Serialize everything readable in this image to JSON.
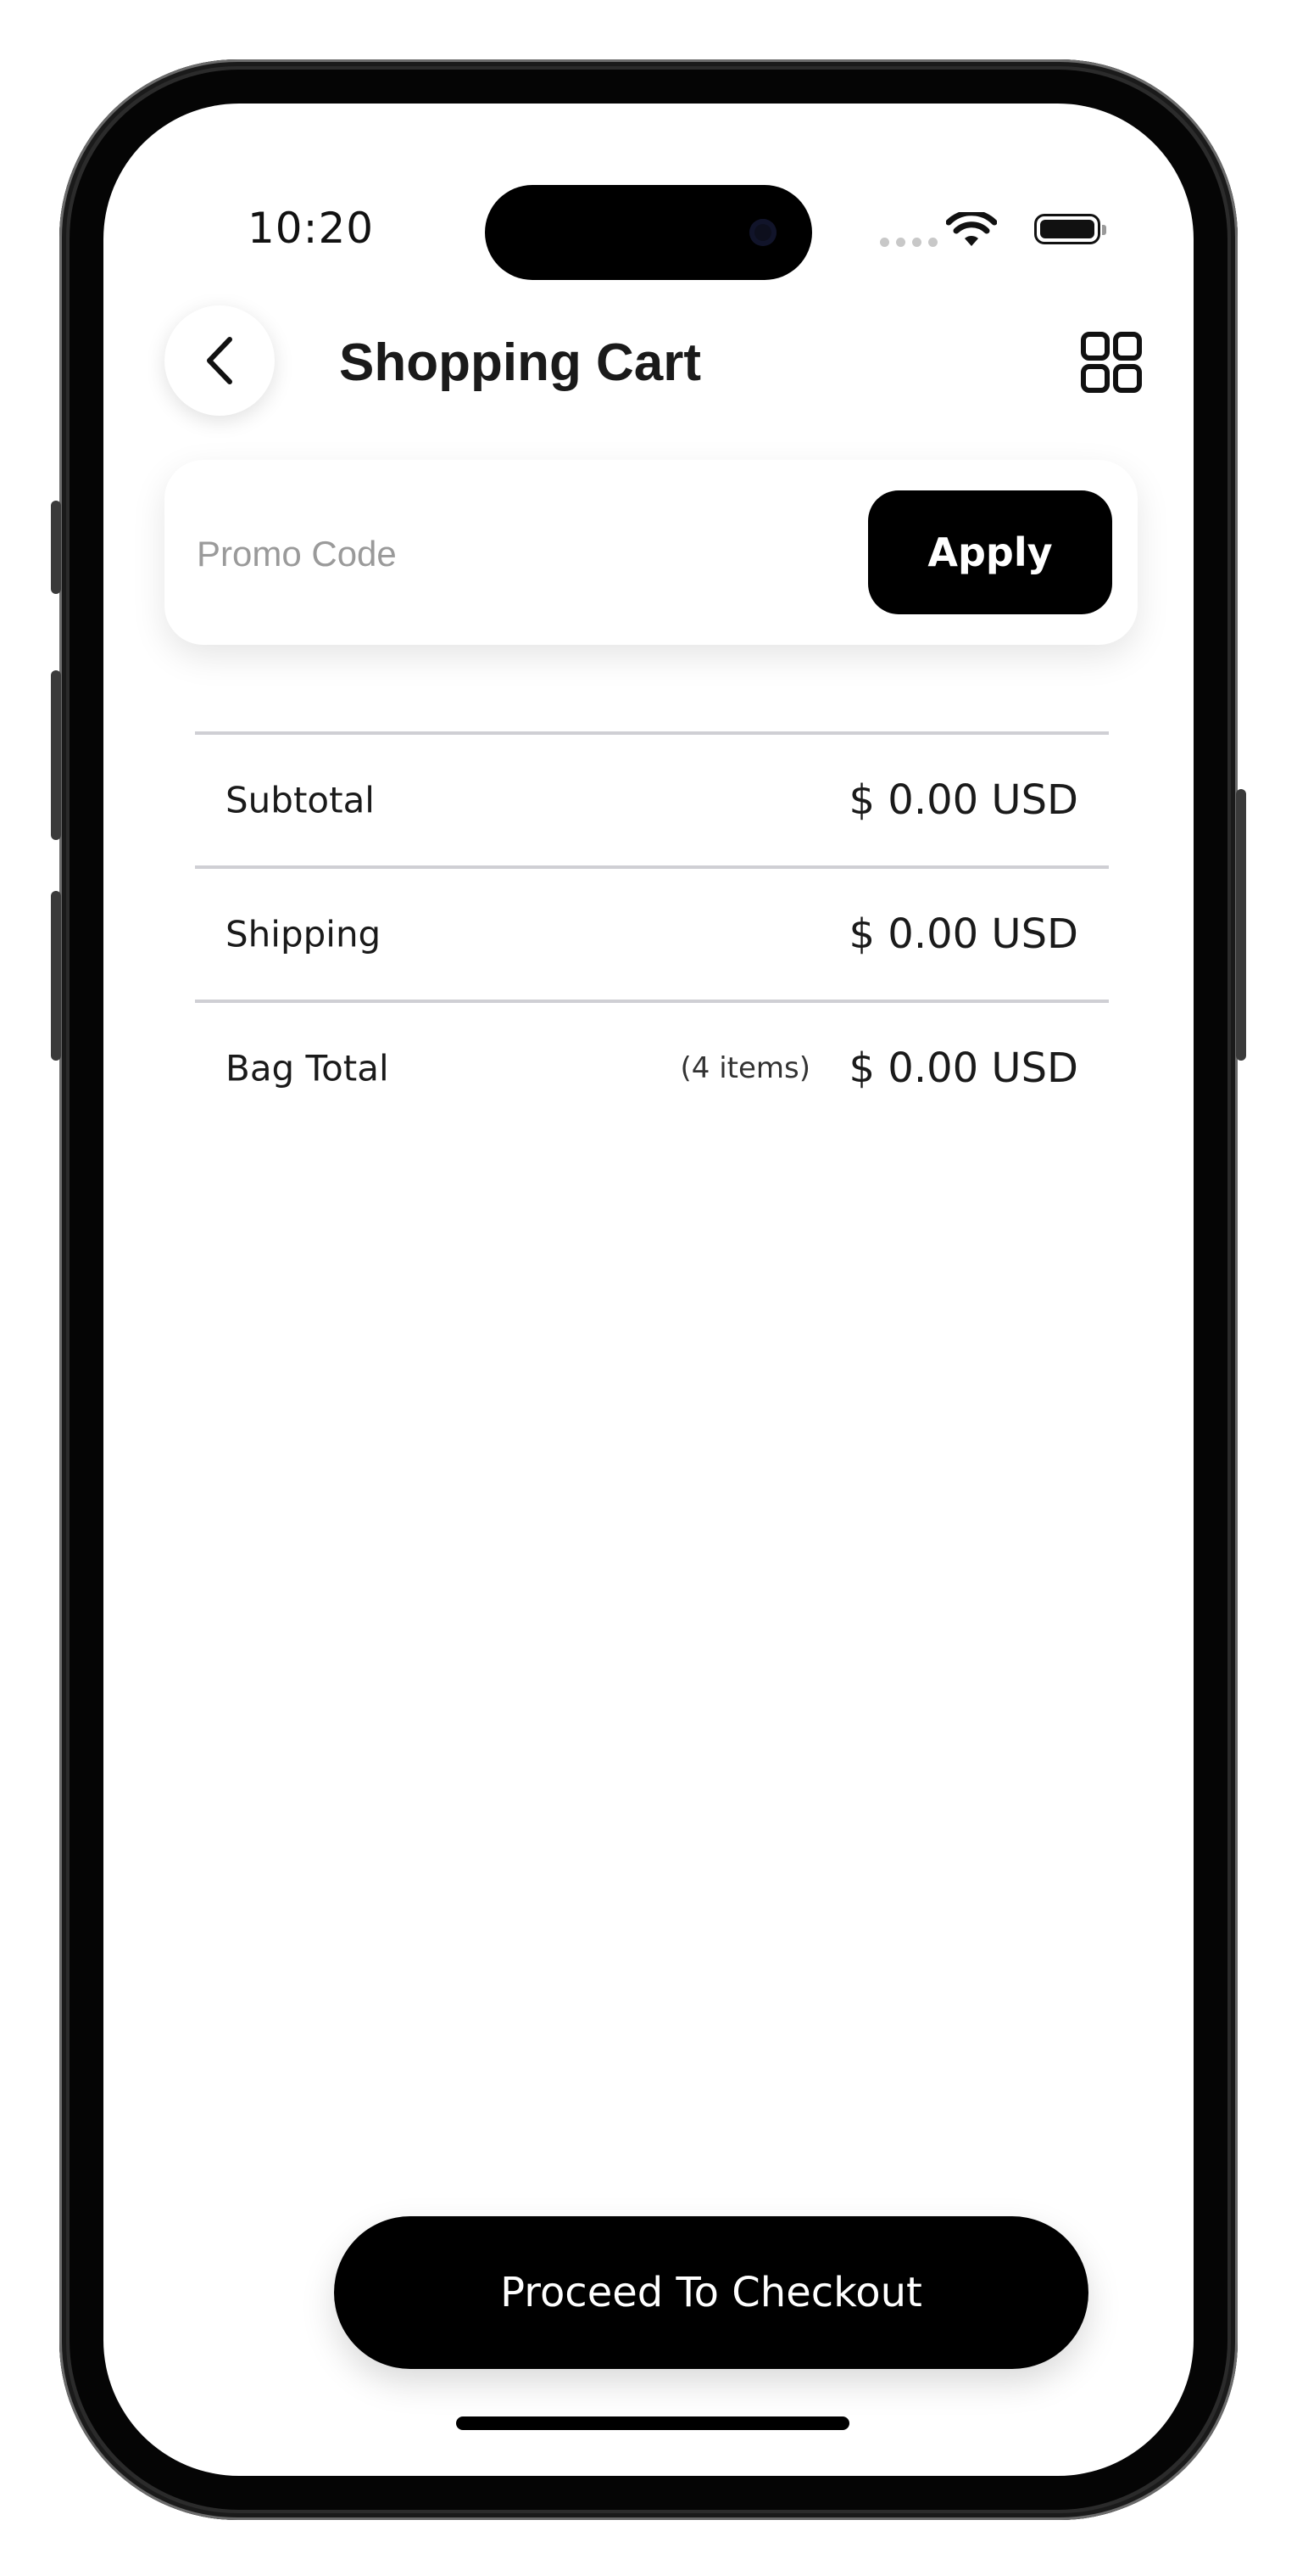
{
  "status_bar": {
    "time": "10:20"
  },
  "header": {
    "title": "Shopping Cart",
    "back_icon": "chevron-left-icon",
    "menu_icon": "grid-icon"
  },
  "promo": {
    "placeholder": "Promo Code",
    "value": "",
    "apply_label": "Apply"
  },
  "summary": {
    "subtotal_label": "Subtotal",
    "subtotal_value": "$ 0.00 USD",
    "shipping_label": "Shipping",
    "shipping_value": "$ 0.00 USD",
    "bag_total_label": "Bag Total",
    "bag_total_items": "(4 items)",
    "bag_total_value": "$ 0.00 USD"
  },
  "checkout": {
    "label": "Proceed To Checkout"
  },
  "colors": {
    "primary": "#000000",
    "background": "#ffffff",
    "divider": "#cfcfd4",
    "placeholder": "#9a9a9a"
  }
}
